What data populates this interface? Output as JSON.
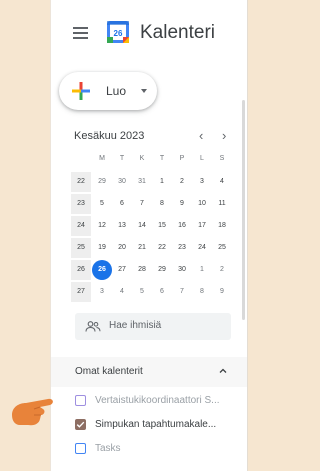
{
  "header": {
    "menu_icon": "hamburger-menu-icon",
    "app_icon": "google-calendar-icon",
    "logo_day": "26",
    "title": "Kalenteri"
  },
  "create": {
    "label": "Luo",
    "icon": "multicolor-plus-icon"
  },
  "mini_calendar": {
    "month_title": "Kesäkuu 2023",
    "prev": "‹",
    "next": "›",
    "weekdays": [
      "M",
      "T",
      "K",
      "T",
      "P",
      "L",
      "S"
    ],
    "weeks": [
      {
        "wk": "22",
        "days": [
          "29",
          "30",
          "31",
          "1",
          "2",
          "3",
          "4"
        ]
      },
      {
        "wk": "23",
        "days": [
          "5",
          "6",
          "7",
          "8",
          "9",
          "10",
          "11"
        ]
      },
      {
        "wk": "24",
        "days": [
          "12",
          "13",
          "14",
          "15",
          "16",
          "17",
          "18"
        ]
      },
      {
        "wk": "25",
        "days": [
          "19",
          "20",
          "21",
          "22",
          "23",
          "24",
          "25"
        ]
      },
      {
        "wk": "26",
        "days": [
          "26",
          "27",
          "28",
          "29",
          "30",
          "1",
          "2"
        ]
      },
      {
        "wk": "27",
        "days": [
          "3",
          "4",
          "5",
          "6",
          "7",
          "8",
          "9"
        ]
      }
    ],
    "today": "26"
  },
  "people_search": {
    "placeholder": "Hae ihmisiä"
  },
  "my_calendars": {
    "title": "Omat kalenterit",
    "items": [
      {
        "label": "Vertaistukikoordinaattori S...",
        "checked": false,
        "color": "#9e8fe0"
      },
      {
        "label": "Simpukan tapahtumakale...",
        "checked": true,
        "color": "#8d6e63"
      },
      {
        "label": "Tasks",
        "checked": false,
        "color": "#4285f4"
      }
    ]
  },
  "colors": {
    "accent": "#1a73e8",
    "pointer_hand": "#e8833a"
  }
}
